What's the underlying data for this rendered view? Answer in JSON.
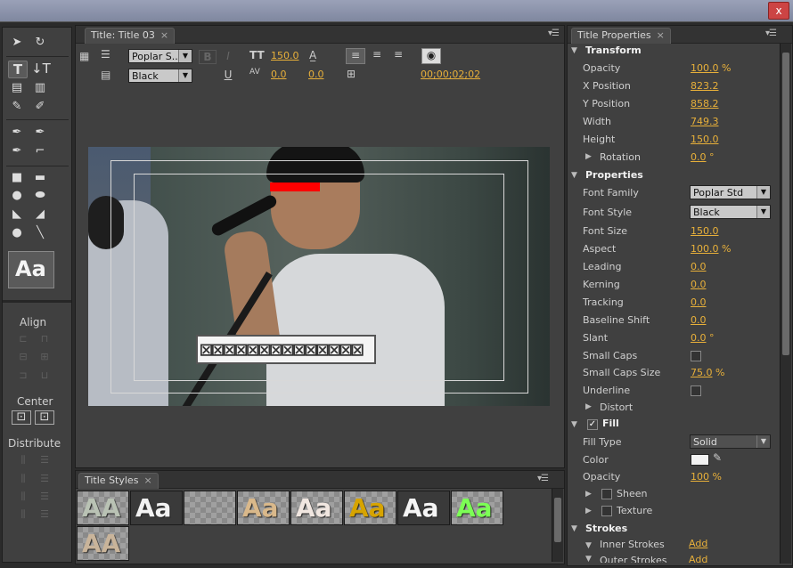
{
  "window": {
    "close_label": "x"
  },
  "tools_panel": {
    "preview_glyph": "Aa",
    "align_label": "Align",
    "center_label": "Center",
    "distribute_label": "Distribute"
  },
  "title_panel": {
    "tab_label": "Title: Title 03",
    "font_family_value": "Poplar S...",
    "font_style_value": "Black",
    "bold_label": "B",
    "italic_label": "I",
    "underline_label": "U",
    "font_size_value": "150.0",
    "kerning_value": "0.0",
    "leading_value": "0.0",
    "timecode": "00;00;02;02",
    "text_glyphs": "⊠⊠⊠⊠⊠⊠⊠⊠⊠⊠⊠⊠⊠⊠"
  },
  "title_styles": {
    "tab_label": "Title Styles",
    "swatches": [
      {
        "glyph": "AA",
        "color": "#b9c2b4",
        "bg": "checker"
      },
      {
        "glyph": "Aa",
        "color": "#f2f2f2",
        "bg": "dark"
      },
      {
        "glyph": "",
        "color": "#7fa0c0",
        "bg": "checker"
      },
      {
        "glyph": "Aa",
        "color": "#d9b88a",
        "bg": "checker"
      },
      {
        "glyph": "Aa",
        "color": "#f0e6e0",
        "bg": "checker"
      },
      {
        "glyph": "Aa",
        "color": "#d7a400",
        "bg": "checker"
      },
      {
        "glyph": "Aa",
        "color": "#f5f5f5",
        "bg": "dark"
      },
      {
        "glyph": "Aa",
        "color": "#7cff55",
        "bg": "checker"
      },
      {
        "glyph": "AA",
        "color": "#c9b49a",
        "bg": "checker"
      }
    ]
  },
  "properties": {
    "tab_label": "Title Properties",
    "transform_label": "Transform",
    "opacity": {
      "label": "Opacity",
      "value": "100.0",
      "unit": "%"
    },
    "x_position": {
      "label": "X Position",
      "value": "823.2"
    },
    "y_position": {
      "label": "Y Position",
      "value": "858.2"
    },
    "width": {
      "label": "Width",
      "value": "749.3"
    },
    "height": {
      "label": "Height",
      "value": "150.0"
    },
    "rotation": {
      "label": "Rotation",
      "value": "0.0",
      "unit": "°"
    },
    "properties_label": "Properties",
    "font_family": {
      "label": "Font Family",
      "value": "Poplar Std"
    },
    "font_style": {
      "label": "Font Style",
      "value": "Black"
    },
    "font_size": {
      "label": "Font Size",
      "value": "150.0"
    },
    "aspect": {
      "label": "Aspect",
      "value": "100.0",
      "unit": "%"
    },
    "leading": {
      "label": "Leading",
      "value": "0.0"
    },
    "kerning": {
      "label": "Kerning",
      "value": "0.0"
    },
    "tracking": {
      "label": "Tracking",
      "value": "0.0"
    },
    "baseline_shift": {
      "label": "Baseline Shift",
      "value": "0.0"
    },
    "slant": {
      "label": "Slant",
      "value": "0.0",
      "unit": "°"
    },
    "small_caps": {
      "label": "Small Caps"
    },
    "small_caps_size": {
      "label": "Small Caps Size",
      "value": "75.0",
      "unit": "%"
    },
    "underline": {
      "label": "Underline"
    },
    "distort_label": "Distort",
    "fill_label": "Fill",
    "fill_type": {
      "label": "Fill Type",
      "value": "Solid"
    },
    "color": {
      "label": "Color",
      "swatch": "#f2f2f2"
    },
    "fill_opacity": {
      "label": "Opacity",
      "value": "100",
      "unit": "%"
    },
    "sheen_label": "Sheen",
    "texture_label": "Texture",
    "strokes_label": "Strokes",
    "inner_strokes": {
      "label": "Inner Strokes",
      "action": "Add"
    },
    "outer_strokes": {
      "label": "Outer Strokes",
      "action": "Add"
    }
  },
  "colors": {
    "accent_value": "#e8b03a",
    "panel_bg": "#404040",
    "red_bar": "#ff0000"
  }
}
